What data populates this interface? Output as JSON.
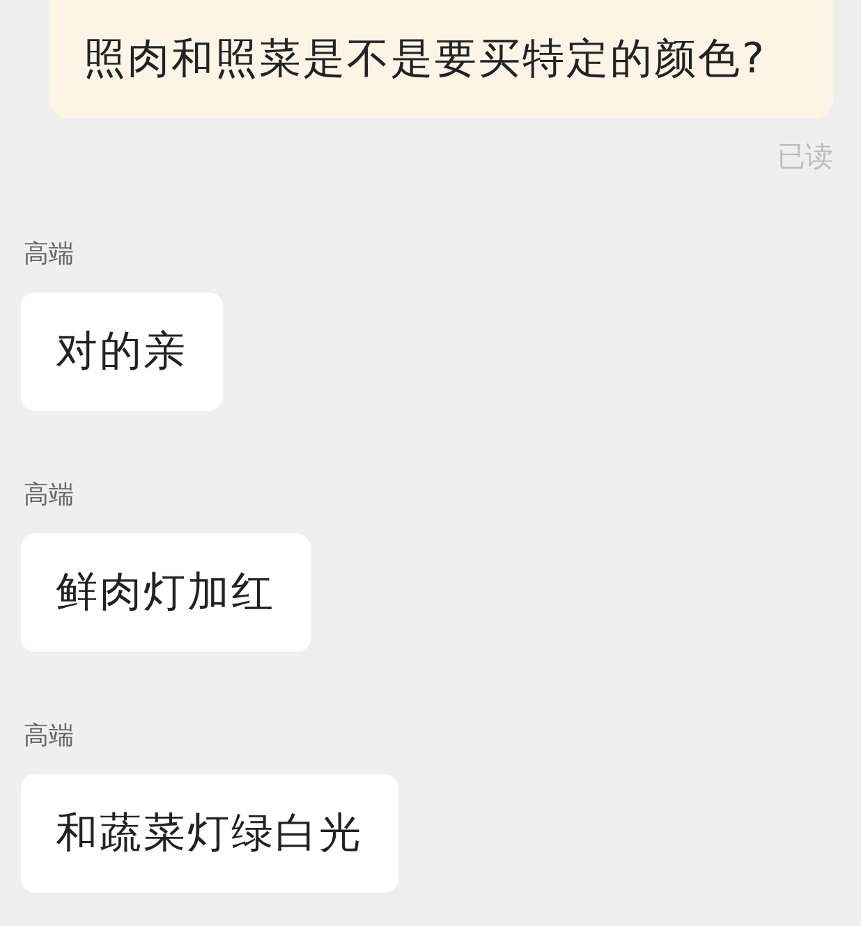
{
  "messages": [
    {
      "kind": "sent",
      "text": "照肉和照菜是不是要买特定的颜色?",
      "status": "已读"
    },
    {
      "kind": "received",
      "sender": "高端",
      "text": "对的亲"
    },
    {
      "kind": "received",
      "sender": "高端",
      "text": "鲜肉灯加红"
    },
    {
      "kind": "received",
      "sender": "高端",
      "text": "和蔬菜灯绿白光"
    }
  ]
}
